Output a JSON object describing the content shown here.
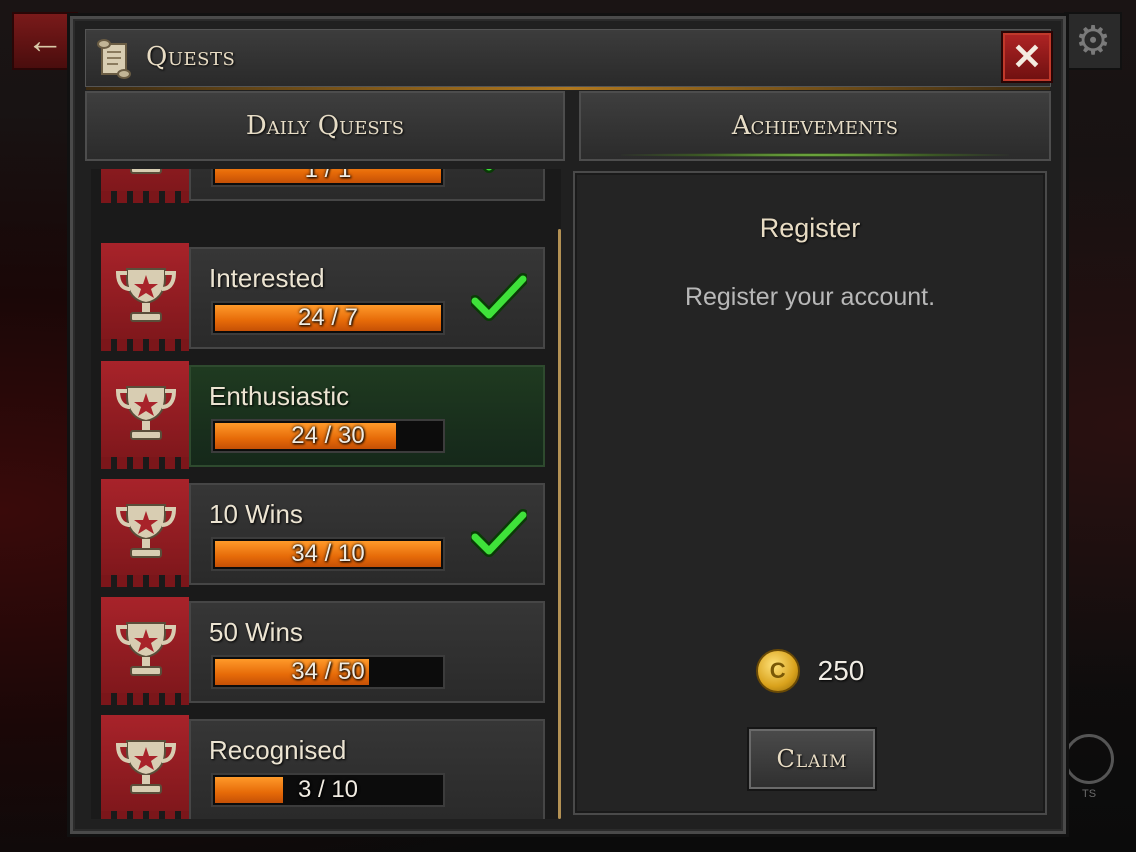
{
  "window": {
    "title": "Quests",
    "close_label": "✕"
  },
  "tabs": [
    {
      "label": "Daily Quests",
      "selected": false
    },
    {
      "label": "Achievements",
      "selected": true
    }
  ],
  "quests": [
    {
      "name": "",
      "progress_text": "1 / 1",
      "progress_fraction": 1.0,
      "completed": true
    },
    {
      "name": "Interested",
      "progress_text": "24 / 7",
      "progress_fraction": 1.0,
      "completed": true
    },
    {
      "name": "Enthusiastic",
      "progress_text": "24 / 30",
      "progress_fraction": 0.8,
      "completed": false,
      "selected": true
    },
    {
      "name": "10 Wins",
      "progress_text": "34 / 10",
      "progress_fraction": 1.0,
      "completed": true
    },
    {
      "name": "50 Wins",
      "progress_text": "34 / 50",
      "progress_fraction": 0.68,
      "completed": false
    },
    {
      "name": "Recognised",
      "progress_text": "3 / 10",
      "progress_fraction": 0.3,
      "completed": false
    }
  ],
  "detail": {
    "title": "Register",
    "description": "Register your account.",
    "reward_amount": "250",
    "coin_symbol": "C",
    "claim_label": "Claim"
  },
  "background": {
    "back_icon": "←",
    "settings_icon": "⚙",
    "quests_label": "TS"
  },
  "colors": {
    "progress": "#e66a08",
    "check": "#3fe23a",
    "emblem": "#a8232a",
    "selected_row": "#1f3a20"
  }
}
